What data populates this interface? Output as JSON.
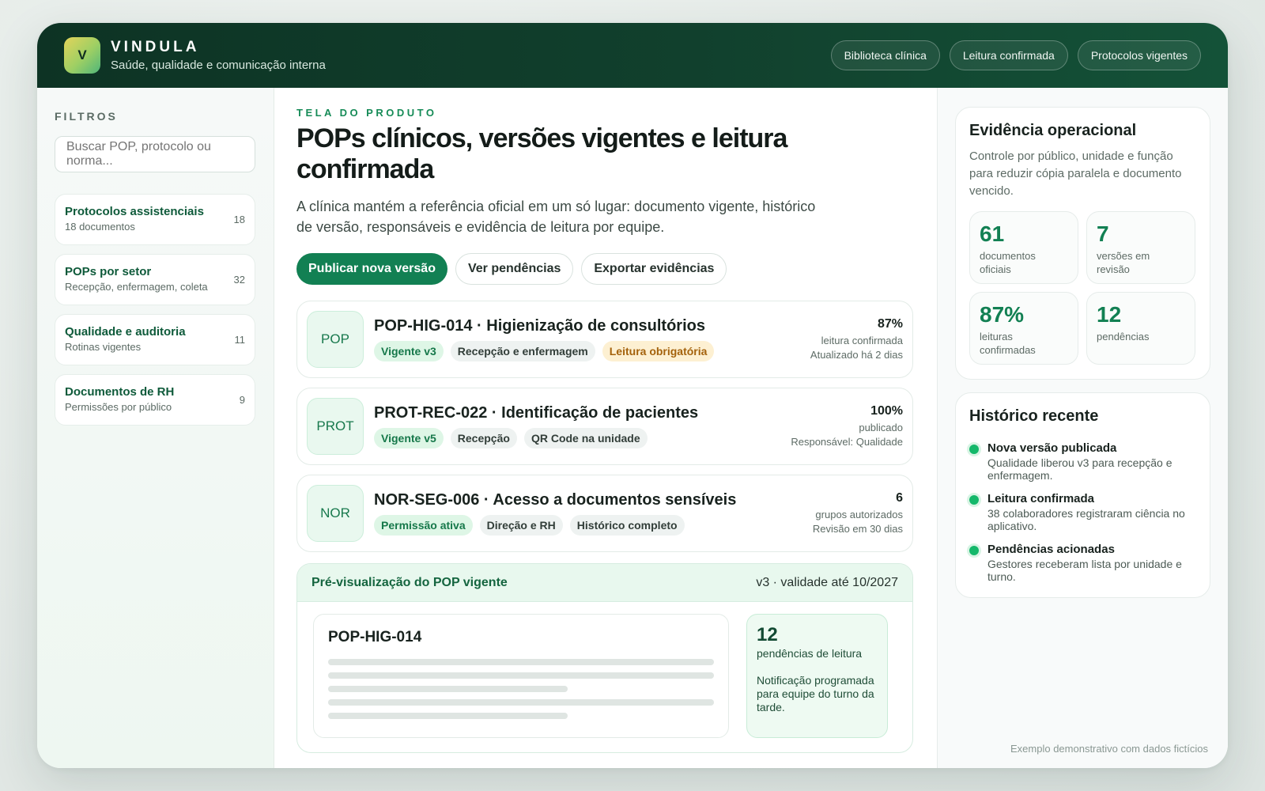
{
  "header": {
    "logo_letter": "V",
    "brand_name": "VINDULA",
    "brand_sub": "Saúde, qualidade e comunicação interna",
    "nav": [
      "Biblioteca clínica",
      "Leitura confirmada",
      "Protocolos vigentes"
    ]
  },
  "sidebar": {
    "title": "FILTROS",
    "search_placeholder": "Buscar POP, protocolo ou norma...",
    "items": [
      {
        "title": "Protocolos assistenciais",
        "sub": "18 documentos",
        "count": "18"
      },
      {
        "title": "POPs por setor",
        "sub": "Recepção, enfermagem, coleta",
        "count": "32"
      },
      {
        "title": "Qualidade e auditoria",
        "sub": "Rotinas vigentes",
        "count": "11"
      },
      {
        "title": "Documentos de RH",
        "sub": "Permissões por público",
        "count": "9"
      }
    ]
  },
  "main": {
    "eyebrow": "TELA DO PRODUTO",
    "title": "POPs clínicos, versões vigentes e leitura confirmada",
    "lead": "A clínica mantém a referência oficial em um só lugar: documento vigente, histórico de versão, responsáveis e evidência de leitura por equipe.",
    "actions": {
      "primary": "Publicar nova versão",
      "pending": "Ver pendências",
      "export": "Exportar evidências"
    },
    "docs": [
      {
        "badge": "POP",
        "title": "POP-HIG-014 · Higienização de consultórios",
        "tags": [
          {
            "label": "Vigente v3",
            "kind": "green"
          },
          {
            "label": "Recepção e enfermagem",
            "kind": "gray"
          },
          {
            "label": "Leitura obrigatória",
            "kind": "amber"
          }
        ],
        "value": "87%",
        "line1": "leitura confirmada",
        "line2": "Atualizado há 2 dias"
      },
      {
        "badge": "PROT",
        "title": "PROT-REC-022 · Identificação de pacientes",
        "tags": [
          {
            "label": "Vigente v5",
            "kind": "green"
          },
          {
            "label": "Recepção",
            "kind": "gray"
          },
          {
            "label": "QR Code na unidade",
            "kind": "gray"
          }
        ],
        "value": "100%",
        "line1": "publicado",
        "line2": "Responsável: Qualidade"
      },
      {
        "badge": "NOR",
        "title": "NOR-SEG-006 · Acesso a documentos sensíveis",
        "tags": [
          {
            "label": "Permissão ativa",
            "kind": "green"
          },
          {
            "label": "Direção e RH",
            "kind": "gray"
          },
          {
            "label": "Histórico completo",
            "kind": "gray"
          }
        ],
        "value": "6",
        "line1": "grupos autorizados",
        "line2": "Revisão em 30 dias"
      }
    ],
    "preview": {
      "title": "Pré-visualização do POP vigente",
      "version": "v3 · validade até 10/2027",
      "sheet_title": "POP-HIG-014",
      "pending_count": "12",
      "pending_label": "pendências de leitura",
      "note": "Notificação programada para equipe do turno da tarde."
    }
  },
  "evidence": {
    "title": "Evidência operacional",
    "desc": "Controle por público, unidade e função para reduzir cópia paralela e documento vencido.",
    "stats": [
      {
        "value": "61",
        "label": "documentos oficiais"
      },
      {
        "value": "7",
        "label": "versões em revisão"
      },
      {
        "value": "87%",
        "label": "leituras confirmadas"
      },
      {
        "value": "12",
        "label": "pendências"
      }
    ]
  },
  "history": {
    "title": "Histórico recente",
    "items": [
      {
        "title": "Nova versão publicada",
        "desc": "Qualidade liberou v3 para recepção e enfermagem."
      },
      {
        "title": "Leitura confirmada",
        "desc": "38 colaboradores registraram ciência no aplicativo."
      },
      {
        "title": "Pendências acionadas",
        "desc": "Gestores receberam lista por unidade e turno."
      }
    ]
  },
  "footnote": "Exemplo demonstrativo com dados fictícios",
  "colors": {
    "accent": "#128053",
    "header": "#11402d",
    "amber_tag": "#a4620c"
  }
}
